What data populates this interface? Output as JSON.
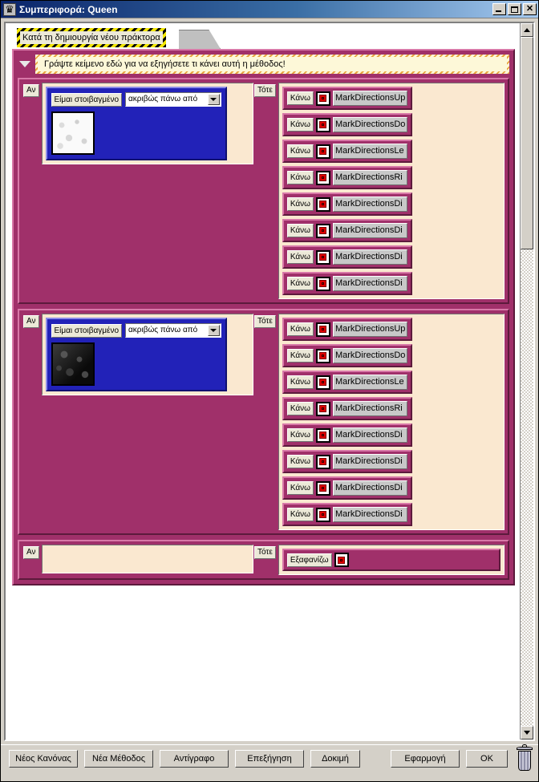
{
  "window": {
    "title": "Συμπεριφορά: Queen",
    "icon": "chess-queen-icon",
    "queen_glyph": "♛",
    "minimize_label": "",
    "maximize_label": "",
    "close_label": "✕"
  },
  "tab": {
    "label": "Κατά τη δημιουργία νέου πράκτορα"
  },
  "comment": {
    "text": "Γράψτε κείμενο εδώ για να εξηγήσετε τι κάνει αυτή η μέθοδος!",
    "toggle": "collapse-triangle-icon"
  },
  "labels": {
    "if": "Αν",
    "then": "Τότε",
    "do": "Κάνω",
    "condition_label": "Είμαι στοιβαγμένο",
    "condition_value": "ακριβώς πάνω από"
  },
  "colors": {
    "rule_magenta": "#a0306a",
    "rule_highlight": "#d878a8",
    "rule_shadow": "#5c1a3c",
    "slot_cream": "#fae8d0",
    "condition_blue": "#2222b8",
    "tab_hazard_yellow": "#f2e600",
    "comment_yellow": "#fdf8d8",
    "comment_hatch": "#e8a33d",
    "titlebar_blue": "#0a246a",
    "face_gray": "#d4d0c8"
  },
  "rules": [
    {
      "if_label": "Αν",
      "then_label": "Τότε",
      "condition": {
        "label": "Είμαι στοιβαγμένο",
        "value": "ακριβώς πάνω από",
        "thumbnail": "white-marble-texture"
      },
      "actions": [
        {
          "verb": "Κάνω",
          "icon": "red-dot-agent-icon",
          "name": "MarkDirectionsUp"
        },
        {
          "verb": "Κάνω",
          "icon": "red-dot-agent-icon",
          "name": "MarkDirectionsDo"
        },
        {
          "verb": "Κάνω",
          "icon": "red-dot-agent-icon",
          "name": "MarkDirectionsLe"
        },
        {
          "verb": "Κάνω",
          "icon": "red-dot-agent-icon",
          "name": "MarkDirectionsRi"
        },
        {
          "verb": "Κάνω",
          "icon": "red-dot-agent-icon",
          "name": "MarkDirectionsDi"
        },
        {
          "verb": "Κάνω",
          "icon": "red-dot-agent-icon",
          "name": "MarkDirectionsDi"
        },
        {
          "verb": "Κάνω",
          "icon": "red-dot-agent-icon",
          "name": "MarkDirectionsDi"
        },
        {
          "verb": "Κάνω",
          "icon": "red-dot-agent-icon",
          "name": "MarkDirectionsDi"
        }
      ]
    },
    {
      "if_label": "Αν",
      "then_label": "Τότε",
      "condition": {
        "label": "Είμαι στοιβαγμένο",
        "value": "ακριβώς πάνω από",
        "thumbnail": "black-marble-texture"
      },
      "actions": [
        {
          "verb": "Κάνω",
          "icon": "red-dot-agent-icon",
          "name": "MarkDirectionsUp"
        },
        {
          "verb": "Κάνω",
          "icon": "red-dot-agent-icon",
          "name": "MarkDirectionsDo"
        },
        {
          "verb": "Κάνω",
          "icon": "red-dot-agent-icon",
          "name": "MarkDirectionsLe"
        },
        {
          "verb": "Κάνω",
          "icon": "red-dot-agent-icon",
          "name": "MarkDirectionsRi"
        },
        {
          "verb": "Κάνω",
          "icon": "red-dot-agent-icon",
          "name": "MarkDirectionsDi"
        },
        {
          "verb": "Κάνω",
          "icon": "red-dot-agent-icon",
          "name": "MarkDirectionsDi"
        },
        {
          "verb": "Κάνω",
          "icon": "red-dot-agent-icon",
          "name": "MarkDirectionsDi"
        },
        {
          "verb": "Κάνω",
          "icon": "red-dot-agent-icon",
          "name": "MarkDirectionsDi"
        }
      ]
    },
    {
      "if_label": "Αν",
      "then_label": "Τότε",
      "condition": null,
      "actions": [
        {
          "verb": "Εξαφανίζω",
          "icon": "red-dot-agent-icon",
          "name": ""
        }
      ]
    }
  ],
  "scrollbar": {
    "up_arrow": "scroll-up-icon",
    "down_arrow": "scroll-down-icon",
    "thumb": "scroll-thumb"
  },
  "buttons": [
    {
      "label": "Νέος Κανόνας",
      "name": "new-rule-button"
    },
    {
      "label": "Νέα Μέθοδος",
      "name": "new-method-button"
    },
    {
      "label": "Αντίγραφο",
      "name": "copy-button"
    },
    {
      "label": "Επεξήγηση",
      "name": "explain-button"
    },
    {
      "label": "Δοκιμή",
      "name": "test-button"
    },
    {
      "label": "Εφαρμογή",
      "name": "apply-button"
    },
    {
      "label": "OK",
      "name": "ok-button"
    }
  ],
  "trash": {
    "name": "trash-can-icon"
  }
}
